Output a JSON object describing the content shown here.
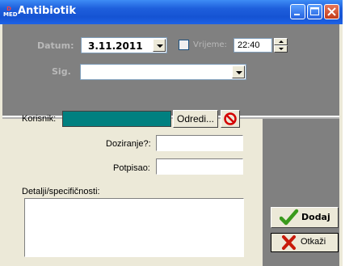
{
  "window": {
    "title": "Antibiotik",
    "icon": {
      "name": "med-app-icon",
      "text_top": "D",
      "text_bottom": "MED"
    }
  },
  "header": {
    "datum_label": "Datum:",
    "datum_value": "3.11.2011",
    "vrijeme_label": "Vrijeme:",
    "vrijeme_checked": false,
    "vrijeme_value": "22:40",
    "sig_label": "Sig.",
    "sig_value": ""
  },
  "form": {
    "korisnik_label": "Korisnik:",
    "odredi_label": "Odredi...",
    "doziranje_label": "Doziranje?:",
    "doziranje_value": "",
    "potpisao_label": "Potpisao:",
    "potpisao_value": "",
    "detalji_label": "Detalji/specifičnosti:",
    "detalji_value": ""
  },
  "actions": {
    "dodaj_label": "Dodaj",
    "otkazi_label": "Otkaži"
  },
  "colors": {
    "titlebar": "#1553d3",
    "panel_grey": "#808080",
    "korisnik_fill": "#008080",
    "clear_icon": "#d40000",
    "check_icon": "#3a9a1c",
    "cancel_icon": "#c81a0a"
  },
  "icons": [
    "minimize-icon",
    "maximize-icon",
    "close-icon",
    "chevron-down-icon",
    "no-entry-icon",
    "checkmark-icon",
    "x-mark-icon"
  ]
}
